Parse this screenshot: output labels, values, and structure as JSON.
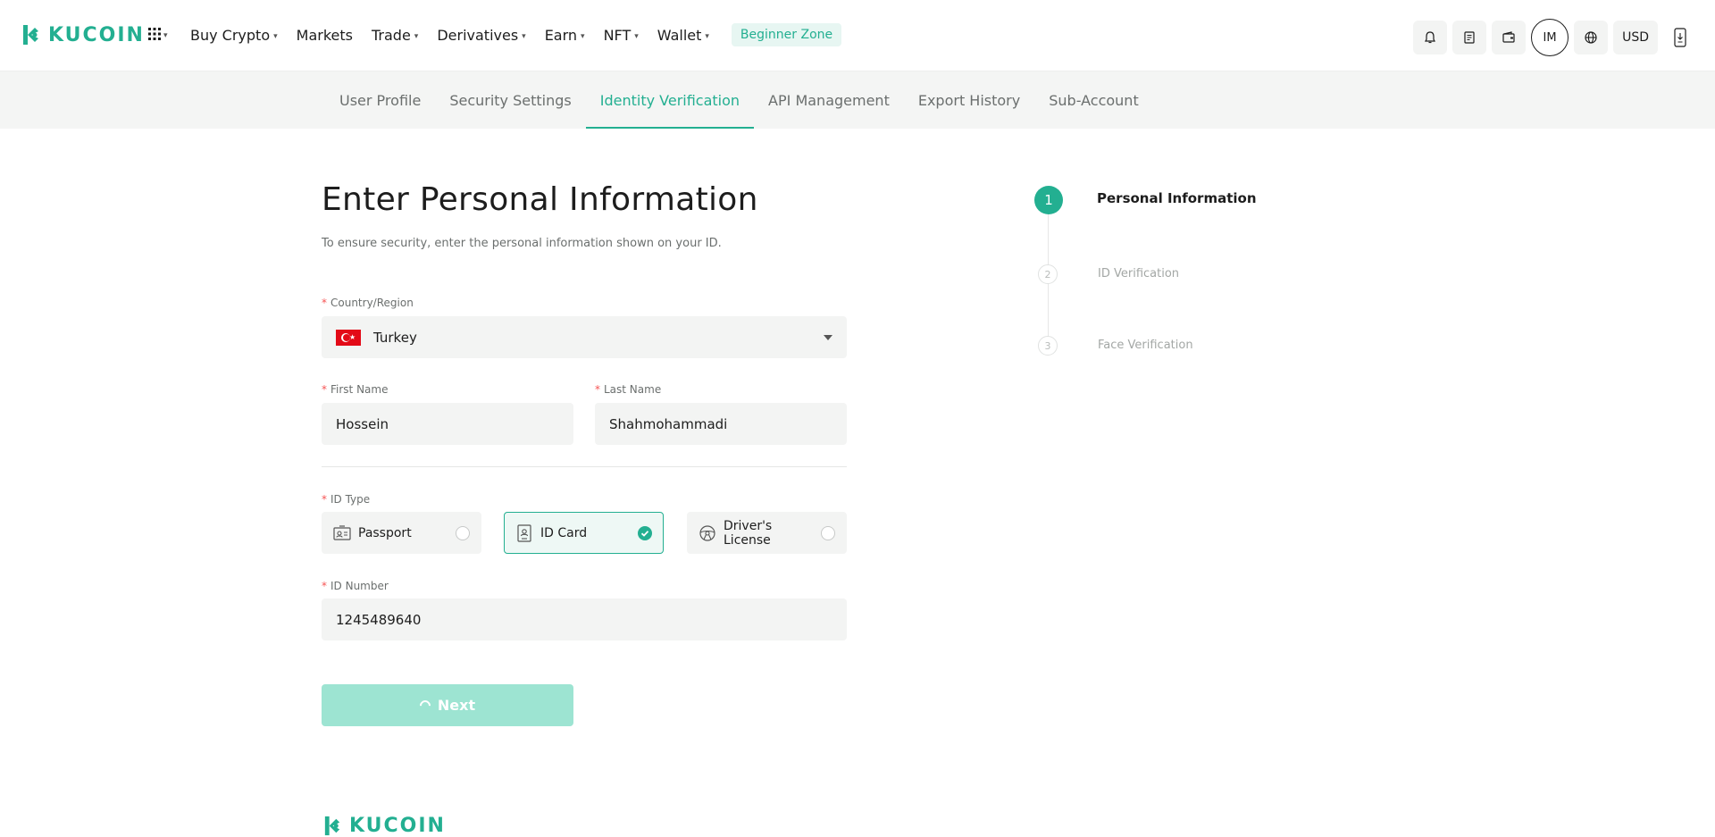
{
  "brand": {
    "name": "KUCOIN"
  },
  "nav": {
    "items": [
      {
        "label": "Buy Crypto",
        "caret": true
      },
      {
        "label": "Markets",
        "caret": false
      },
      {
        "label": "Trade",
        "caret": true
      },
      {
        "label": "Derivatives",
        "caret": true
      },
      {
        "label": "Earn",
        "caret": true
      },
      {
        "label": "NFT",
        "caret": true
      },
      {
        "label": "Wallet",
        "caret": true
      }
    ],
    "beginner_zone": "Beginner Zone",
    "avatar_initials": "IM",
    "currency": "USD",
    "icons": [
      "bell-icon",
      "orders-icon",
      "wallet-icon",
      "globe-icon",
      "download-icon"
    ]
  },
  "tabs": [
    {
      "label": "User Profile",
      "active": false
    },
    {
      "label": "Security Settings",
      "active": false
    },
    {
      "label": "Identity Verification",
      "active": true
    },
    {
      "label": "API Management",
      "active": false
    },
    {
      "label": "Export History",
      "active": false
    },
    {
      "label": "Sub-Account",
      "active": false
    }
  ],
  "form": {
    "title": "Enter Personal Information",
    "subtitle": "To ensure security, enter the personal information shown on your ID.",
    "country": {
      "label": "Country/Region",
      "value": "Turkey"
    },
    "first_name": {
      "label": "First Name",
      "value": "Hossein"
    },
    "last_name": {
      "label": "Last Name",
      "value": "Shahmohammadi"
    },
    "id_type": {
      "label": "ID Type",
      "options": [
        {
          "label": "Passport",
          "selected": false
        },
        {
          "label": "ID Card",
          "selected": true
        },
        {
          "label": "Driver's License",
          "selected": false
        }
      ]
    },
    "id_number": {
      "label": "ID Number",
      "value": "1245489640"
    },
    "next_label": "Next"
  },
  "steps": [
    {
      "number": "1",
      "label": "Personal Information",
      "active": true
    },
    {
      "number": "2",
      "label": "ID Verification",
      "active": false
    },
    {
      "number": "3",
      "label": "Face Verification",
      "active": false
    }
  ],
  "colors": {
    "accent": "#23af91",
    "accent_light": "#9de4d2",
    "required": "#f65454"
  }
}
